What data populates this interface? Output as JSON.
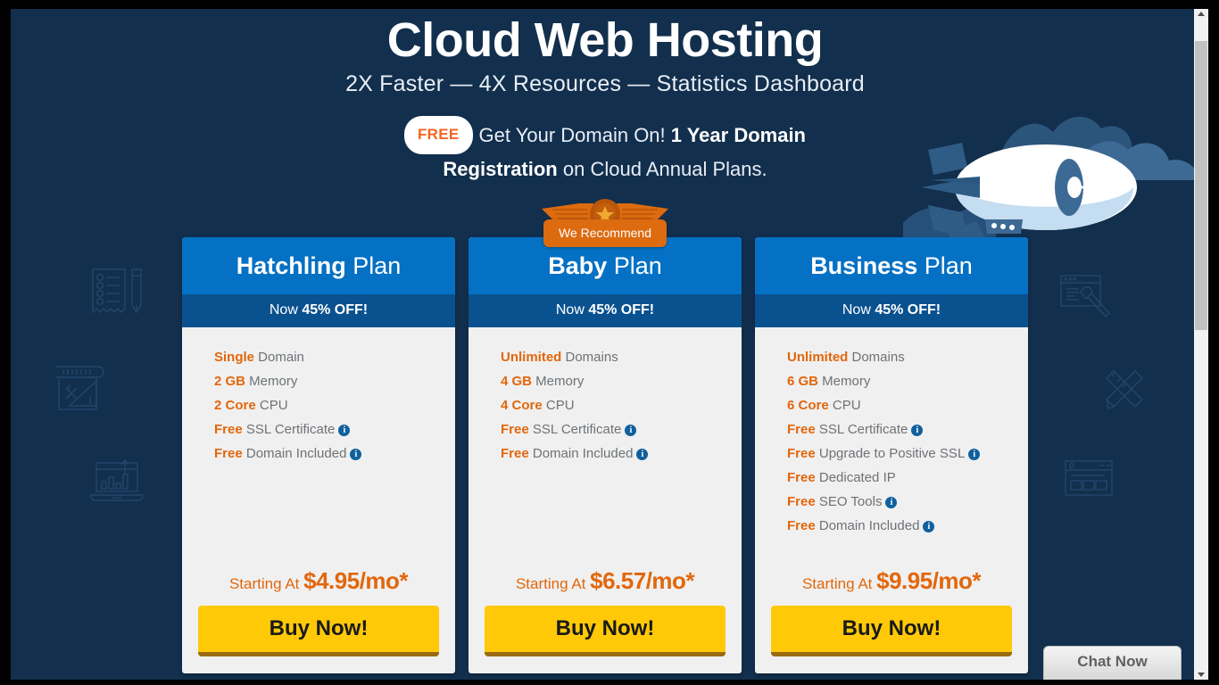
{
  "page": {
    "title": "Cloud Web Hosting",
    "subtitle": "2X Faster — 4X Resources — Statistics Dashboard",
    "promo": {
      "badge": "FREE",
      "line1_pre": "Get Your Domain On! ",
      "line1_bold": "1 Year Domain",
      "line2_bold": "Registration",
      "line2_post": " on Cloud Annual Plans."
    },
    "colors": {
      "background": "#122F4D",
      "card_header": "#0571C4",
      "card_subheader": "#0A5190",
      "card_body": "#F0F0F0",
      "accent_orange": "#E2670C",
      "buy_button": "#FFC907",
      "buy_button_shadow": "#9A6A10",
      "info_icon": "#11609E",
      "ribbon": "#DD6B10"
    }
  },
  "recommend_badge": {
    "label": "We Recommend",
    "icon": "star-medal-wings-icon"
  },
  "plans": [
    {
      "name_bold": "Hatchling",
      "name_rest": " Plan",
      "discount_pre": "Now ",
      "discount_bold": "45% OFF!",
      "features": [
        {
          "bold": "Single",
          "rest": " Domain",
          "info": false
        },
        {
          "bold": "2 GB",
          "rest": " Memory",
          "info": false
        },
        {
          "bold": "2 Core",
          "rest": " CPU",
          "info": false
        },
        {
          "bold": "Free",
          "rest": " SSL Certificate",
          "info": true
        },
        {
          "bold": "Free",
          "rest": " Domain Included",
          "info": true
        }
      ],
      "price_pre": "Starting At ",
      "price": "$4.95/mo*",
      "buy_label": "Buy Now!",
      "recommended": false
    },
    {
      "name_bold": "Baby",
      "name_rest": " Plan",
      "discount_pre": "Now ",
      "discount_bold": "45% OFF!",
      "features": [
        {
          "bold": "Unlimited",
          "rest": " Domains",
          "info": false
        },
        {
          "bold": "4 GB",
          "rest": " Memory",
          "info": false
        },
        {
          "bold": "4 Core",
          "rest": " CPU",
          "info": false
        },
        {
          "bold": "Free",
          "rest": " SSL Certificate",
          "info": true
        },
        {
          "bold": "Free",
          "rest": " Domain Included",
          "info": true
        }
      ],
      "price_pre": "Starting At ",
      "price": "$6.57/mo*",
      "buy_label": "Buy Now!",
      "recommended": true
    },
    {
      "name_bold": "Business",
      "name_rest": " Plan",
      "discount_pre": "Now ",
      "discount_bold": "45% OFF!",
      "features": [
        {
          "bold": "Unlimited",
          "rest": " Domains",
          "info": false
        },
        {
          "bold": "6 GB",
          "rest": " Memory",
          "info": false
        },
        {
          "bold": "6 Core",
          "rest": " CPU",
          "info": false
        },
        {
          "bold": "Free",
          "rest": " SSL Certificate",
          "info": true
        },
        {
          "bold": "Free",
          "rest": " Upgrade to Positive SSL",
          "info": true
        },
        {
          "bold": "Free",
          "rest": " Dedicated IP",
          "info": false
        },
        {
          "bold": "Free",
          "rest": " SEO Tools",
          "info": true
        },
        {
          "bold": "Free",
          "rest": " Domain Included",
          "info": true
        }
      ],
      "price_pre": "Starting At ",
      "price": "$9.95/mo*",
      "buy_label": "Buy Now!",
      "recommended": false
    }
  ],
  "chat_widget": {
    "label": "Chat Now"
  },
  "decorations": {
    "airship": "blimp-illustration",
    "left_icons": [
      "checklist-pencil-icon",
      "blueprint-ruler-icon",
      "laptop-chart-icon"
    ],
    "right_icons": [
      "browser-paintbrush-icon",
      "crossed-ruler-pencil-icon",
      "browser-layout-icon"
    ]
  }
}
